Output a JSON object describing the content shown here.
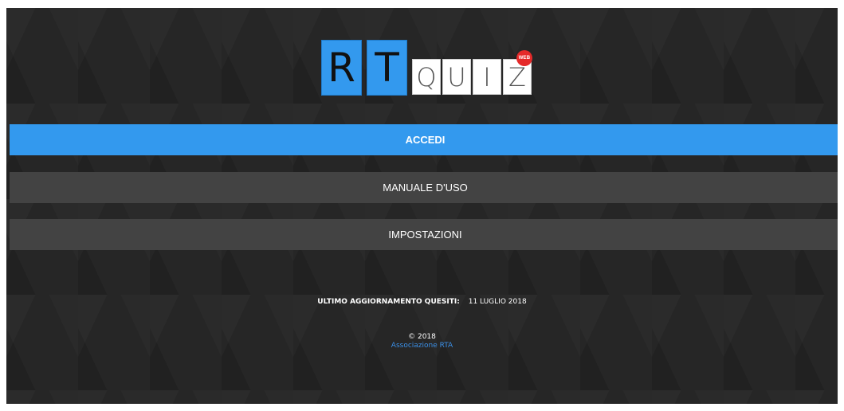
{
  "logo": {
    "big_letters": [
      "R",
      "T"
    ],
    "small_letters": [
      "Q",
      "U",
      "I",
      "Z"
    ],
    "badge": "WEB",
    "colors": {
      "big_tile": "#3399ee",
      "small_tile": "#ffffff",
      "badge": "#e52a2a"
    }
  },
  "menu": {
    "login_label": "ACCEDI",
    "manual_label": "MANUALE D'USO",
    "settings_label": "IMPOSTAZIONI"
  },
  "footer": {
    "update_label": "ULTIMO AGGIORNAMENTO QUESITI:",
    "update_date": "11 LUGLIO 2018",
    "copyright": "© 2018",
    "association_link": "Associazione RTA"
  },
  "colors": {
    "background": "#262626",
    "accent": "#3399ee",
    "secondary_button": "#434343",
    "link": "#3b8fe6"
  }
}
